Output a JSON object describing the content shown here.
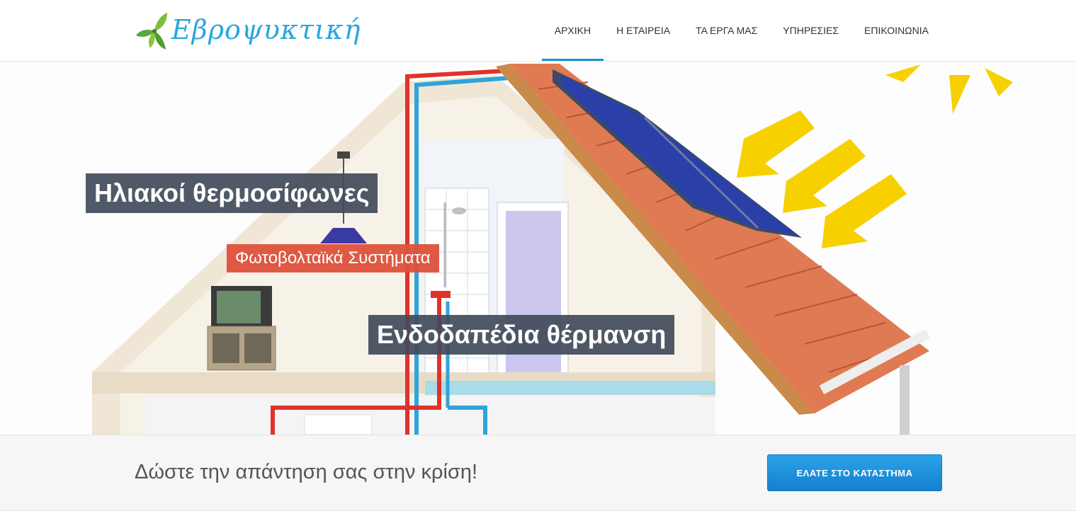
{
  "brand": {
    "name": "Εβροψυκτική"
  },
  "nav": {
    "items": [
      {
        "label": "ΑΡΧΙΚΗ",
        "active": true
      },
      {
        "label": "Η ΕΤΑΙΡΕΙΑ"
      },
      {
        "label": "ΤΑ ΕΡΓΑ ΜΑΣ"
      },
      {
        "label": "ΥΠΗΡΕΣΙΕΣ"
      },
      {
        "label": "ΕΠΙΚΟΙΝΩΝΙΑ"
      }
    ]
  },
  "hero": {
    "caption1": "Ηλιακοί θερμοσίφωνες",
    "caption2": "Φωτοβολταϊκά Συστήματα",
    "caption3": "Ενδοδαπέδια θέρμανση"
  },
  "cta": {
    "text": "Δώστε την απάντηση σας στην κρίση!",
    "button": "ΕΛΑΤΕ ΣΤΟ ΚΑΤΑΣΤΗΜΑ"
  },
  "colors": {
    "accent": "#1e8fd6",
    "brand_blue": "#2aa6dd",
    "caption_dark": "#414b5a",
    "caption_red": "#de503a",
    "roof": "#e07a52",
    "sun_arrow": "#f7d000"
  }
}
